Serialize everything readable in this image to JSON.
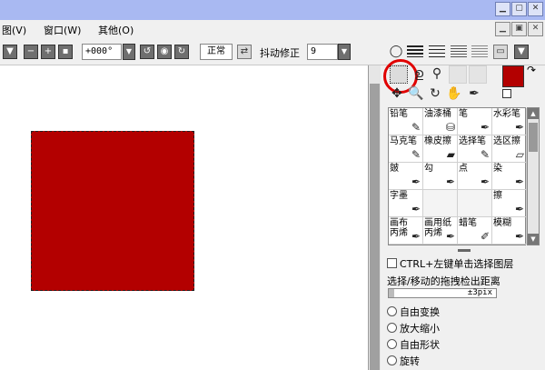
{
  "titlebar": {
    "minimize_icon": "minimize-icon",
    "maximize_icon": "maximize-icon",
    "close_icon": "close-icon"
  },
  "menubar": {
    "items": [
      "图(V)",
      "窗口(W)",
      "其他(O)"
    ]
  },
  "toolbar": {
    "angle_value": "+000°",
    "blend_mode": "正常",
    "stabilizer_label": "抖动修正",
    "stabilizer_value": "9"
  },
  "canvas": {
    "shape_color": "#b30000"
  },
  "colors": {
    "main": "#b30000",
    "sub": "#ffffff"
  },
  "brushes": [
    {
      "label": "铅笔",
      "icon": "pencil-icon"
    },
    {
      "label": "油漆桶",
      "icon": "paint-bucket-icon"
    },
    {
      "label": "笔",
      "icon": "pen-icon"
    },
    {
      "label": "水彩笔",
      "icon": "watercolor-icon"
    },
    {
      "label": "马克笔",
      "icon": "marker-icon"
    },
    {
      "label": "橡皮擦",
      "icon": "eraser-icon"
    },
    {
      "label": "选择笔",
      "icon": "select-pen-icon"
    },
    {
      "label": "选区擦",
      "icon": "select-eraser-icon"
    },
    {
      "label": "皴",
      "icon": "brush-icon"
    },
    {
      "label": "勾",
      "icon": "brush-icon"
    },
    {
      "label": "点",
      "icon": "brush-icon"
    },
    {
      "label": "染",
      "icon": "brush-icon"
    },
    {
      "label": "字墨",
      "icon": "brush-icon"
    },
    {
      "label": "",
      "icon": ""
    },
    {
      "label": "",
      "icon": ""
    },
    {
      "label": "擦",
      "icon": "brush-icon"
    },
    {
      "label": "画布\n丙烯",
      "icon": "brush-icon"
    },
    {
      "label": "画用纸\n丙烯",
      "icon": "brush-icon"
    },
    {
      "label": "蜡笔",
      "icon": "crayon-icon"
    },
    {
      "label": "模糊",
      "icon": "blur-icon"
    }
  ],
  "options": {
    "ctrl_select_label": "CTRL+左键单击选择图层",
    "drag_distance_label": "选择/移动的拖拽检出距离",
    "drag_distance_value": "±3pix",
    "drag_distance_fraction": 0.05,
    "radio_items": [
      "自由变换",
      "放大缩小",
      "自由形状",
      "旋转"
    ]
  }
}
